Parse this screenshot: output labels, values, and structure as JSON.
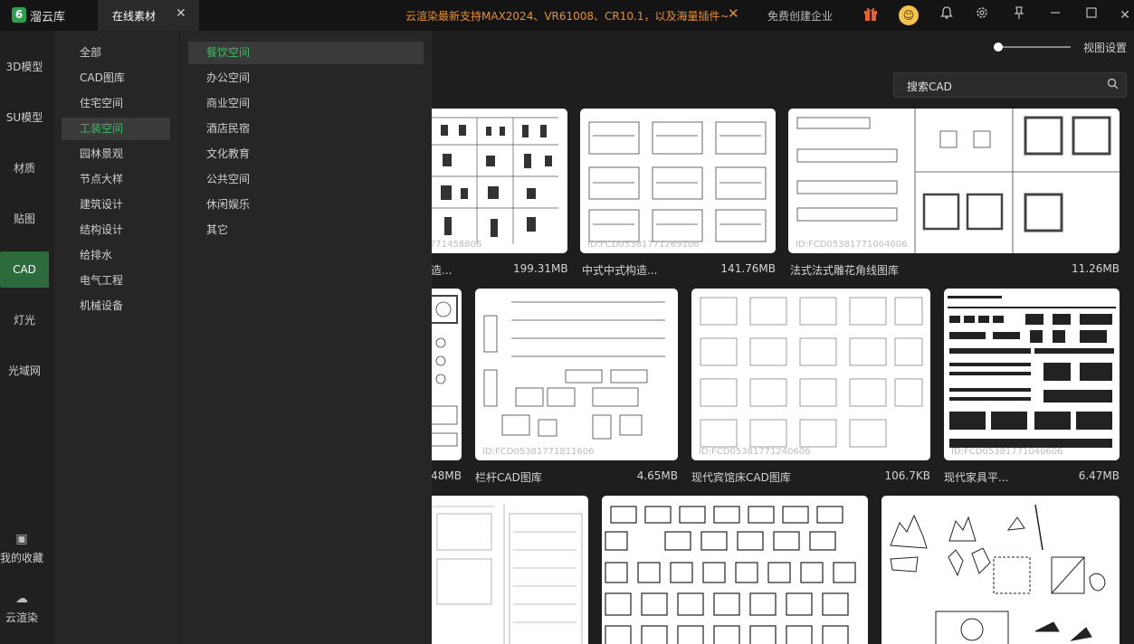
{
  "titlebar": {
    "app_logo": "6",
    "app_name": "溜云库",
    "active_tab": "在线素材",
    "promo": "云渲染最新支持MAX2024、VR61008、CR10.1，以及海量插件~",
    "enterprise": "免费创建企业",
    "icons": [
      "gift-icon",
      "avatar",
      "bell-icon",
      "gear-icon",
      "pin-icon",
      "minimize-icon",
      "maximize-icon",
      "close-icon"
    ]
  },
  "leftnav": {
    "items": [
      {
        "label": "3D模型"
      },
      {
        "label": "SU模型"
      },
      {
        "label": "材质"
      },
      {
        "label": "贴图"
      },
      {
        "label": "CAD"
      },
      {
        "label": "灯光"
      },
      {
        "label": "光域网"
      }
    ],
    "active": "CAD",
    "bottom": [
      {
        "label": "我的收藏",
        "icon": "favorites-icon"
      },
      {
        "label": "云渲染",
        "icon": "cloud-render-icon"
      }
    ]
  },
  "categories": {
    "items": [
      "全部",
      "CAD图库",
      "住宅空间",
      "工装空间",
      "园林景观",
      "节点大样",
      "建筑设计",
      "结构设计",
      "给排水",
      "电气工程",
      "机械设备"
    ],
    "active": "工装空间"
  },
  "subcategories": {
    "items": [
      "餐饮空间",
      "办公空间",
      "商业空间",
      "酒店民宿",
      "文化教育",
      "公共空间",
      "休闲娱乐",
      "其它"
    ],
    "active": "餐饮空间"
  },
  "toolbar": {
    "view_settings": "视图设置",
    "search_placeholder": "搜索CAD",
    "slider_level": 0.0
  },
  "cards": [
    {
      "id_text": "771458806",
      "name": "造...",
      "size": "199.31MB"
    },
    {
      "id_text": "ID:FCD05381771269106",
      "name": "中式中式构造...",
      "size": "141.76MB"
    },
    {
      "id_text": "ID:FCD05381771004606",
      "name": "法式法式雕花角线图库",
      "size": "11.26MB"
    },
    {
      "id_text": "",
      "name": "",
      "size": "48MB"
    },
    {
      "id_text": "ID:FCD05381771811606",
      "name": "栏杆CAD图库",
      "size": "4.65MB"
    },
    {
      "id_text": "ID:FCD05381771240606",
      "name": "现代宾馆床CAD图库",
      "size": "106.7KB"
    },
    {
      "id_text": "ID:FCD05381771040606",
      "name": "现代家具平...",
      "size": "6.47MB"
    },
    {
      "id_text": "",
      "name": "",
      "size": ""
    },
    {
      "id_text": "",
      "name": "",
      "size": ""
    },
    {
      "id_text": "",
      "name": "",
      "size": ""
    }
  ]
}
